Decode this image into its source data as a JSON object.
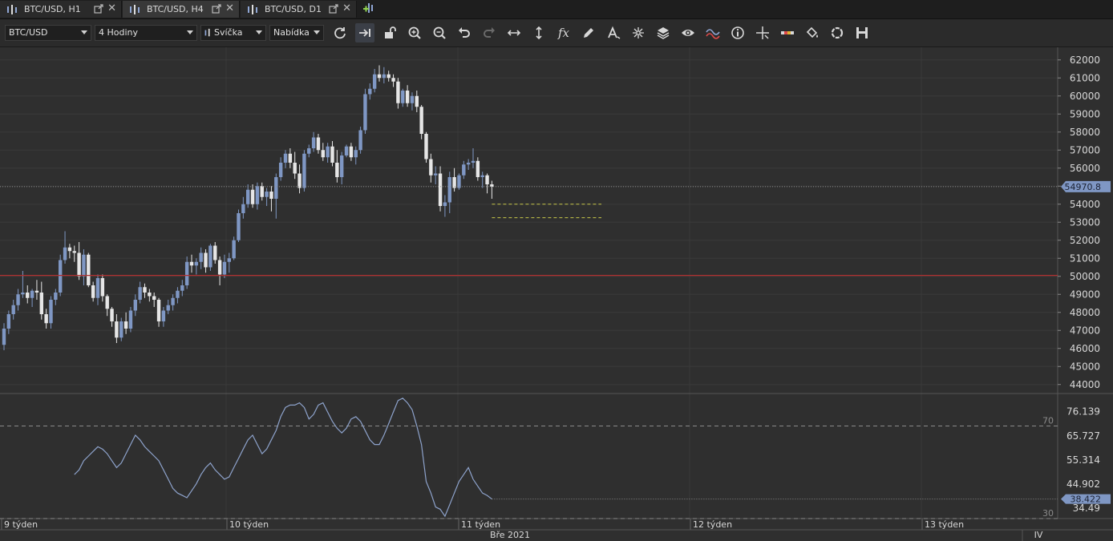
{
  "tabs": [
    {
      "label": "BTC/USD, H1",
      "active": false
    },
    {
      "label": "BTC/USD, H4",
      "active": true
    },
    {
      "label": "BTC/USD, D1",
      "active": false
    }
  ],
  "toolbar": {
    "symbol": "BTC/USD",
    "timeframe": "4 Hodiny",
    "chart_type": "Svíčka",
    "menu": "Nabídka",
    "icons": [
      "refresh-icon",
      "scroll-to-end-icon",
      "unlock-icon",
      "zoom-in-icon",
      "zoom-out-icon",
      "undo-icon",
      "redo-icon",
      "horizontal-arrows-icon",
      "vertical-arrows-icon",
      "function-icon",
      "pencil-icon",
      "text-tool-icon",
      "crosshair-star-icon",
      "layers-icon",
      "eye-icon",
      "indicator-wave-icon",
      "info-icon",
      "crosshair-icon",
      "color-palette-icon",
      "paint-bucket-icon",
      "circle-icon",
      "save-icon"
    ]
  },
  "colors": {
    "background": "#2f2f2f",
    "bull_candle": "#7f97c4",
    "bear_candle": "#e6e6e6",
    "resistance_line": "#b03030",
    "support_dashed": "#c8c84a",
    "rsi_line": "#8ea3cc",
    "price_badge": "#7f97c4"
  },
  "chart_data": [
    {
      "type": "candlestick",
      "symbol": "BTC/USD",
      "timeframe": "H4",
      "ylim": [
        43500,
        62700
      ],
      "yticks": [
        44000,
        45000,
        46000,
        47000,
        48000,
        49000,
        50000,
        51000,
        52000,
        53000,
        54000,
        55000,
        56000,
        57000,
        58000,
        59000,
        60000,
        61000,
        62000
      ],
      "last_price": "54970.8",
      "horizontal_line": 50050,
      "support_zone": [
        54000,
        53250
      ],
      "candles": [
        [
          46200,
          47400,
          45900,
          47100
        ],
        [
          47100,
          48100,
          46800,
          47900
        ],
        [
          47900,
          48700,
          47600,
          48400
        ],
        [
          48400,
          49300,
          48100,
          49000
        ],
        [
          49000,
          50300,
          48800,
          49100
        ],
        [
          49100,
          49500,
          48500,
          48800
        ],
        [
          48800,
          49300,
          48300,
          49200
        ],
        [
          49200,
          49800,
          48700,
          49100
        ],
        [
          49100,
          49700,
          47600,
          47900
        ],
        [
          47900,
          48200,
          47100,
          47400
        ],
        [
          47400,
          48900,
          47100,
          48700
        ],
        [
          48700,
          49300,
          48400,
          49100
        ],
        [
          49100,
          51200,
          48900,
          50900
        ],
        [
          50900,
          52500,
          50700,
          51600
        ],
        [
          51600,
          51800,
          51000,
          51400
        ],
        [
          51400,
          51700,
          50800,
          51300
        ],
        [
          51300,
          51900,
          49800,
          50000
        ],
        [
          50000,
          51500,
          49500,
          51200
        ],
        [
          51200,
          51300,
          49400,
          49500
        ],
        [
          49500,
          49700,
          48600,
          48800
        ],
        [
          48800,
          50100,
          48400,
          49900
        ],
        [
          49900,
          50100,
          48600,
          48900
        ],
        [
          48900,
          49000,
          47800,
          48200
        ],
        [
          48200,
          48300,
          47200,
          47500
        ],
        [
          47500,
          47900,
          46300,
          46600
        ],
        [
          46600,
          47700,
          46400,
          47500
        ],
        [
          47500,
          48000,
          46800,
          47100
        ],
        [
          47100,
          48300,
          46900,
          48100
        ],
        [
          48100,
          49000,
          47800,
          48700
        ],
        [
          48700,
          49700,
          48500,
          49400
        ],
        [
          49400,
          49600,
          48800,
          49100
        ],
        [
          49100,
          49300,
          48600,
          48900
        ],
        [
          48900,
          49100,
          48300,
          48700
        ],
        [
          48700,
          48800,
          47200,
          47500
        ],
        [
          47500,
          48300,
          47200,
          48100
        ],
        [
          48100,
          48700,
          47900,
          48400
        ],
        [
          48400,
          49000,
          48100,
          48800
        ],
        [
          48800,
          49400,
          48500,
          49200
        ],
        [
          49200,
          49800,
          48900,
          49500
        ],
        [
          49500,
          51100,
          49300,
          50800
        ],
        [
          50800,
          51200,
          50200,
          50600
        ],
        [
          50600,
          51000,
          50100,
          50800
        ],
        [
          50800,
          51600,
          50400,
          51300
        ],
        [
          51300,
          51500,
          50200,
          50500
        ],
        [
          50500,
          51800,
          50300,
          51700
        ],
        [
          51700,
          51900,
          50700,
          50900
        ],
        [
          50900,
          51100,
          49500,
          50100
        ],
        [
          50100,
          51200,
          49900,
          50800
        ],
        [
          50800,
          51300,
          50200,
          51000
        ],
        [
          51000,
          52200,
          50900,
          52000
        ],
        [
          52000,
          53700,
          51900,
          53500
        ],
        [
          53500,
          54400,
          53200,
          54000
        ],
        [
          54000,
          55100,
          53800,
          54800
        ],
        [
          54800,
          55100,
          53800,
          54000
        ],
        [
          54000,
          55200,
          53700,
          55000
        ],
        [
          55000,
          55200,
          54200,
          54400
        ],
        [
          54400,
          54900,
          53900,
          54700
        ],
        [
          54700,
          55000,
          53600,
          54300
        ],
        [
          54300,
          55700,
          53200,
          55500
        ],
        [
          55500,
          56600,
          55300,
          56300
        ],
        [
          56300,
          57000,
          56000,
          56800
        ],
        [
          56800,
          57100,
          56000,
          56300
        ],
        [
          56300,
          56900,
          55400,
          55700
        ],
        [
          55700,
          56200,
          54600,
          54900
        ],
        [
          54900,
          57000,
          54700,
          56800
        ],
        [
          56800,
          57300,
          56600,
          57100
        ],
        [
          57100,
          58000,
          56900,
          57700
        ],
        [
          57700,
          57900,
          56800,
          57000
        ],
        [
          57000,
          57400,
          56400,
          56600
        ],
        [
          56600,
          57400,
          56300,
          57200
        ],
        [
          57200,
          57500,
          56100,
          56300
        ],
        [
          56300,
          57000,
          55200,
          55500
        ],
        [
          55500,
          56900,
          55100,
          56700
        ],
        [
          56700,
          57300,
          56600,
          57200
        ],
        [
          57200,
          57400,
          56400,
          56600
        ],
        [
          56600,
          57200,
          56200,
          57000
        ],
        [
          57000,
          58300,
          56800,
          58100
        ],
        [
          58100,
          60400,
          57900,
          60100
        ],
        [
          60100,
          60700,
          59800,
          60400
        ],
        [
          60400,
          61500,
          60200,
          61200
        ],
        [
          61200,
          61700,
          60800,
          61000
        ],
        [
          61000,
          61600,
          60700,
          61200
        ],
        [
          61200,
          61400,
          60800,
          61000
        ],
        [
          61000,
          61200,
          60500,
          60800
        ],
        [
          60800,
          61000,
          59300,
          59600
        ],
        [
          59600,
          60400,
          59400,
          60300
        ],
        [
          60300,
          60600,
          59400,
          59600
        ],
        [
          59600,
          60200,
          59200,
          60000
        ],
        [
          60000,
          60300,
          59100,
          59400
        ],
        [
          59400,
          59500,
          57600,
          57900
        ],
        [
          57900,
          58000,
          56300,
          56500
        ],
        [
          56500,
          56800,
          55200,
          55600
        ],
        [
          55600,
          56100,
          55100,
          55700
        ],
        [
          55700,
          56100,
          53600,
          53900
        ],
        [
          53900,
          54500,
          53300,
          54100
        ],
        [
          54100,
          55800,
          53500,
          55500
        ],
        [
          55500,
          56000,
          54700,
          54900
        ],
        [
          54900,
          55700,
          54800,
          55600
        ],
        [
          55600,
          56400,
          55400,
          56200
        ],
        [
          56200,
          56500,
          55900,
          56300
        ],
        [
          56300,
          57100,
          56000,
          56400
        ],
        [
          56400,
          56600,
          55300,
          55500
        ],
        [
          55500,
          55800,
          54900,
          55600
        ],
        [
          55600,
          55700,
          54600,
          55100
        ],
        [
          55100,
          55300,
          54300,
          54970.8
        ]
      ]
    },
    {
      "type": "line",
      "name": "RSI",
      "ylim": [
        30,
        84
      ],
      "yticks": [
        "76.139",
        "65.727",
        "55.314",
        "44.902",
        "34.49"
      ],
      "levels": [
        70,
        30
      ],
      "last_value": "38.422",
      "values": [
        49,
        51,
        55,
        57,
        59,
        61,
        60,
        58,
        55,
        52,
        54,
        58,
        62,
        66,
        64,
        61,
        59,
        57,
        55,
        51,
        47,
        43,
        41,
        40,
        39,
        42,
        45,
        49,
        52,
        54,
        51,
        49,
        47,
        48,
        52,
        56,
        60,
        64,
        66,
        62,
        58,
        60,
        64,
        68,
        74,
        78,
        79,
        79,
        80,
        78,
        73,
        75,
        79,
        80,
        76,
        72,
        69,
        67,
        69,
        73,
        74,
        72,
        68,
        64,
        62,
        62,
        66,
        71,
        76,
        81,
        82,
        80,
        77,
        70,
        62,
        46,
        41,
        35,
        34,
        31,
        36,
        41,
        46,
        49,
        52,
        47,
        44,
        41,
        40,
        38.4
      ]
    }
  ],
  "time_axis": {
    "labels": [
      "9 týden",
      "10 týden",
      "11 týden",
      "12 týden",
      "13 týden"
    ],
    "month_label": "Bře 2021",
    "corner": "IV"
  }
}
